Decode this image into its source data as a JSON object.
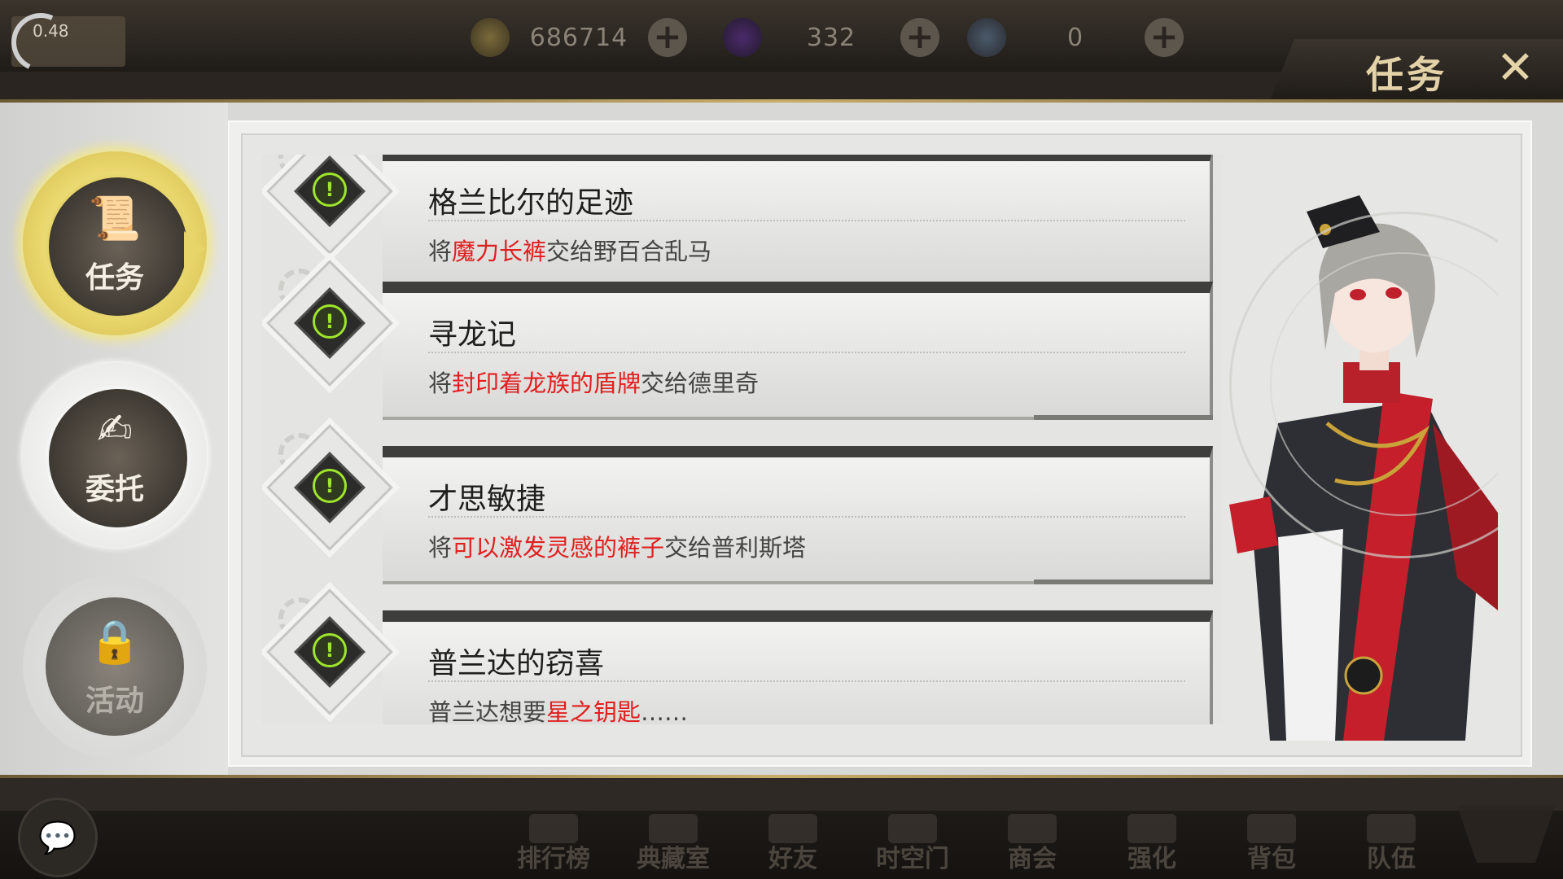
{
  "topbar": {
    "level_text": "0.48",
    "currencies": [
      {
        "icon": "gold-coin-icon",
        "value": "686714",
        "color": "#8a7338"
      },
      {
        "icon": "purple-crystal-icon",
        "value": "332",
        "color": "#5a2d8c"
      },
      {
        "icon": "rainbow-orb-icon",
        "value": "0",
        "color": "#6a7a8c"
      }
    ],
    "title": "任务",
    "close_glyph": "✕"
  },
  "sidebar": {
    "items": [
      {
        "label": "任务",
        "icon": "quest-scroll-icon",
        "active": true
      },
      {
        "label": "委托",
        "icon": "commission-document-icon",
        "active": false
      },
      {
        "label": "活动",
        "icon": "locked-chains-icon",
        "active": false,
        "locked": true
      }
    ]
  },
  "quests": [
    {
      "title": "格兰比尔的足迹",
      "desc_pre": "将",
      "desc_hl": "魔力长裤",
      "desc_post": "交给野百合乱马"
    },
    {
      "title": "寻龙记",
      "desc_pre": "将",
      "desc_hl": "封印着龙族的盾牌",
      "desc_post": "交给德里奇"
    },
    {
      "title": "才思敏捷",
      "desc_pre": "将",
      "desc_hl": "可以激发灵感的裤子",
      "desc_post": "交给普利斯塔"
    },
    {
      "title": "普兰达的窃喜",
      "desc_pre": "普兰达想要",
      "desc_hl": "星之钥匙",
      "desc_post": "……"
    }
  ],
  "bottom_nav": {
    "chat_icon": "chat-bubble-icon",
    "items": [
      "排行榜",
      "典藏室",
      "好友",
      "时空门",
      "商会",
      "强化",
      "背包",
      "队伍"
    ]
  },
  "colors": {
    "highlight": "#e01f1f",
    "accent_gold": "#e8d56a",
    "bang_green": "#9ee52b"
  }
}
